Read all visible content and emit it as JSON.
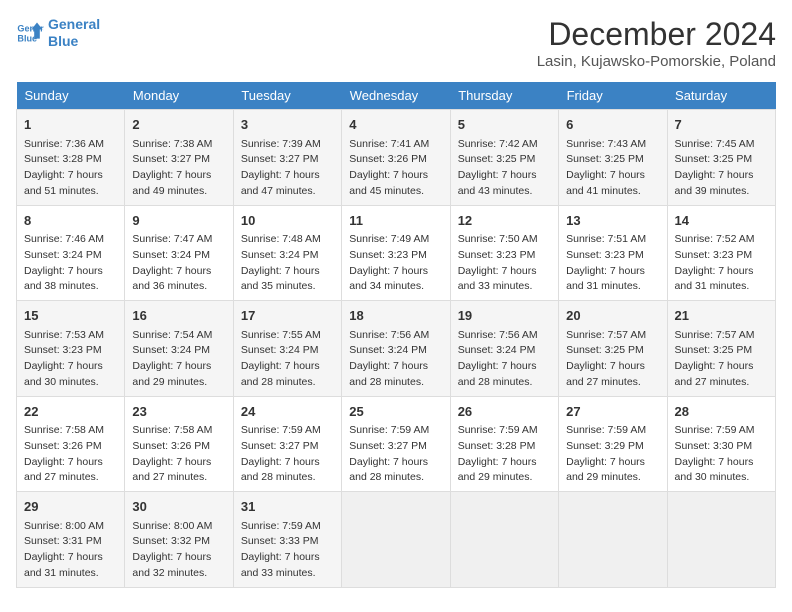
{
  "logo": {
    "line1": "General",
    "line2": "Blue"
  },
  "title": "December 2024",
  "subtitle": "Lasin, Kujawsko-Pomorskie, Poland",
  "days_of_week": [
    "Sunday",
    "Monday",
    "Tuesday",
    "Wednesday",
    "Thursday",
    "Friday",
    "Saturday"
  ],
  "weeks": [
    [
      {
        "day": "1",
        "info": "Sunrise: 7:36 AM\nSunset: 3:28 PM\nDaylight: 7 hours\nand 51 minutes."
      },
      {
        "day": "2",
        "info": "Sunrise: 7:38 AM\nSunset: 3:27 PM\nDaylight: 7 hours\nand 49 minutes."
      },
      {
        "day": "3",
        "info": "Sunrise: 7:39 AM\nSunset: 3:27 PM\nDaylight: 7 hours\nand 47 minutes."
      },
      {
        "day": "4",
        "info": "Sunrise: 7:41 AM\nSunset: 3:26 PM\nDaylight: 7 hours\nand 45 minutes."
      },
      {
        "day": "5",
        "info": "Sunrise: 7:42 AM\nSunset: 3:25 PM\nDaylight: 7 hours\nand 43 minutes."
      },
      {
        "day": "6",
        "info": "Sunrise: 7:43 AM\nSunset: 3:25 PM\nDaylight: 7 hours\nand 41 minutes."
      },
      {
        "day": "7",
        "info": "Sunrise: 7:45 AM\nSunset: 3:25 PM\nDaylight: 7 hours\nand 39 minutes."
      }
    ],
    [
      {
        "day": "8",
        "info": "Sunrise: 7:46 AM\nSunset: 3:24 PM\nDaylight: 7 hours\nand 38 minutes."
      },
      {
        "day": "9",
        "info": "Sunrise: 7:47 AM\nSunset: 3:24 PM\nDaylight: 7 hours\nand 36 minutes."
      },
      {
        "day": "10",
        "info": "Sunrise: 7:48 AM\nSunset: 3:24 PM\nDaylight: 7 hours\nand 35 minutes."
      },
      {
        "day": "11",
        "info": "Sunrise: 7:49 AM\nSunset: 3:23 PM\nDaylight: 7 hours\nand 34 minutes."
      },
      {
        "day": "12",
        "info": "Sunrise: 7:50 AM\nSunset: 3:23 PM\nDaylight: 7 hours\nand 33 minutes."
      },
      {
        "day": "13",
        "info": "Sunrise: 7:51 AM\nSunset: 3:23 PM\nDaylight: 7 hours\nand 31 minutes."
      },
      {
        "day": "14",
        "info": "Sunrise: 7:52 AM\nSunset: 3:23 PM\nDaylight: 7 hours\nand 31 minutes."
      }
    ],
    [
      {
        "day": "15",
        "info": "Sunrise: 7:53 AM\nSunset: 3:23 PM\nDaylight: 7 hours\nand 30 minutes."
      },
      {
        "day": "16",
        "info": "Sunrise: 7:54 AM\nSunset: 3:24 PM\nDaylight: 7 hours\nand 29 minutes."
      },
      {
        "day": "17",
        "info": "Sunrise: 7:55 AM\nSunset: 3:24 PM\nDaylight: 7 hours\nand 28 minutes."
      },
      {
        "day": "18",
        "info": "Sunrise: 7:56 AM\nSunset: 3:24 PM\nDaylight: 7 hours\nand 28 minutes."
      },
      {
        "day": "19",
        "info": "Sunrise: 7:56 AM\nSunset: 3:24 PM\nDaylight: 7 hours\nand 28 minutes."
      },
      {
        "day": "20",
        "info": "Sunrise: 7:57 AM\nSunset: 3:25 PM\nDaylight: 7 hours\nand 27 minutes."
      },
      {
        "day": "21",
        "info": "Sunrise: 7:57 AM\nSunset: 3:25 PM\nDaylight: 7 hours\nand 27 minutes."
      }
    ],
    [
      {
        "day": "22",
        "info": "Sunrise: 7:58 AM\nSunset: 3:26 PM\nDaylight: 7 hours\nand 27 minutes."
      },
      {
        "day": "23",
        "info": "Sunrise: 7:58 AM\nSunset: 3:26 PM\nDaylight: 7 hours\nand 27 minutes."
      },
      {
        "day": "24",
        "info": "Sunrise: 7:59 AM\nSunset: 3:27 PM\nDaylight: 7 hours\nand 28 minutes."
      },
      {
        "day": "25",
        "info": "Sunrise: 7:59 AM\nSunset: 3:27 PM\nDaylight: 7 hours\nand 28 minutes."
      },
      {
        "day": "26",
        "info": "Sunrise: 7:59 AM\nSunset: 3:28 PM\nDaylight: 7 hours\nand 29 minutes."
      },
      {
        "day": "27",
        "info": "Sunrise: 7:59 AM\nSunset: 3:29 PM\nDaylight: 7 hours\nand 29 minutes."
      },
      {
        "day": "28",
        "info": "Sunrise: 7:59 AM\nSunset: 3:30 PM\nDaylight: 7 hours\nand 30 minutes."
      }
    ],
    [
      {
        "day": "29",
        "info": "Sunrise: 8:00 AM\nSunset: 3:31 PM\nDaylight: 7 hours\nand 31 minutes."
      },
      {
        "day": "30",
        "info": "Sunrise: 8:00 AM\nSunset: 3:32 PM\nDaylight: 7 hours\nand 32 minutes."
      },
      {
        "day": "31",
        "info": "Sunrise: 7:59 AM\nSunset: 3:33 PM\nDaylight: 7 hours\nand 33 minutes."
      },
      null,
      null,
      null,
      null
    ]
  ]
}
